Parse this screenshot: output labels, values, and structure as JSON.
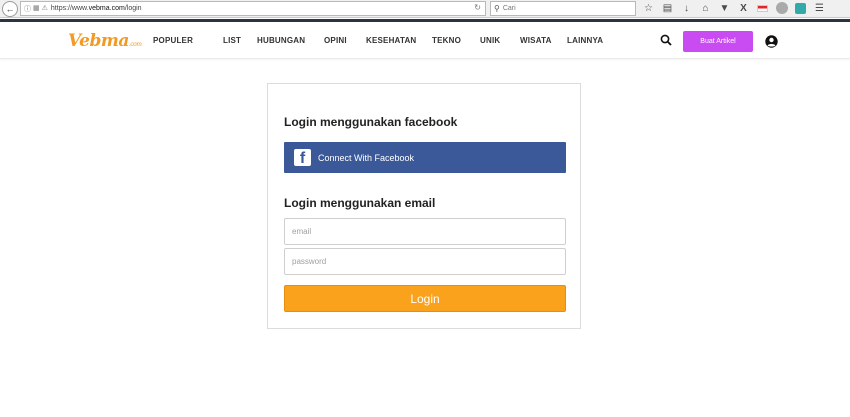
{
  "browser": {
    "url_prefix": "https://www.",
    "url_domain": "vebma.com",
    "url_path": "/login",
    "search_placeholder": "Cari",
    "icons": [
      "back-arrow-icon",
      "info-icon",
      "reader-icon",
      "lock-warning-icon",
      "reload-icon",
      "search-icon",
      "bookmark-star-icon",
      "library-icon",
      "download-icon",
      "home-icon",
      "pocket-icon",
      "x-icon",
      "flag-icon",
      "abp-icon",
      "extension-icon",
      "menu-icon"
    ]
  },
  "header": {
    "logo_text": "Vebma",
    "logo_suffix": ".com",
    "nav": [
      "POPULER",
      "LIST",
      "HUBUNGAN",
      "OPINI",
      "KESEHATAN",
      "TEKNO",
      "UNIK",
      "WISATA",
      "LAINNYA"
    ],
    "create_button": "Buat Artikel",
    "accent": "#c94cf2"
  },
  "login": {
    "facebook_heading": "Login menggunakan facebook",
    "facebook_button": "Connect With Facebook",
    "facebook_icon_glyph": "f",
    "email_heading": "Login menggunakan email",
    "email_placeholder": "email",
    "password_placeholder": "password",
    "login_button": "Login",
    "fb_color": "#3b5998",
    "login_color": "#fba21c"
  }
}
